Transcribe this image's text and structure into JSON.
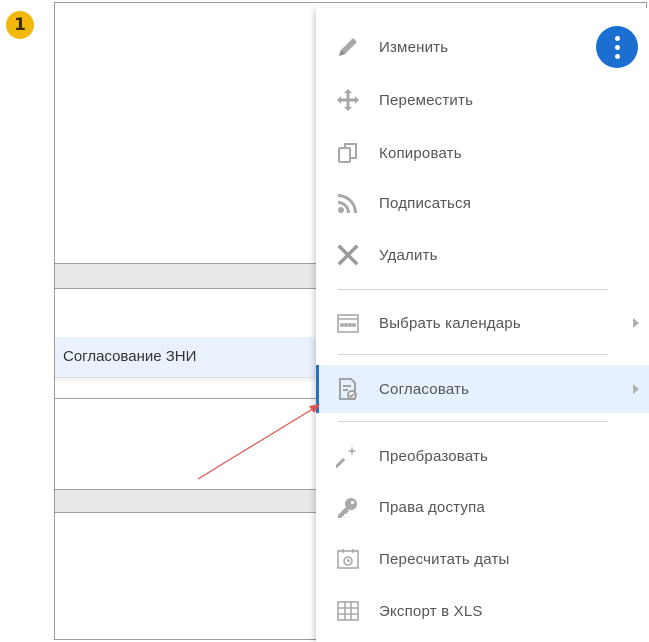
{
  "step_number": "1",
  "background": {
    "row_label": "Согласование ЗНИ"
  },
  "menu": {
    "items": [
      {
        "label": "Изменить",
        "icon": "pencil-icon"
      },
      {
        "label": "Переместить",
        "icon": "move-icon"
      },
      {
        "label": "Копировать",
        "icon": "copy-icon"
      },
      {
        "label": "Подписаться",
        "icon": "rss-icon"
      },
      {
        "label": "Удалить",
        "icon": "close-icon"
      },
      {
        "label": "Выбрать календарь",
        "icon": "calendar-icon",
        "has_submenu": true
      },
      {
        "label": "Согласовать",
        "icon": "approve-icon",
        "has_submenu": true,
        "active": true
      },
      {
        "label": "Преобразовать",
        "icon": "magic-wand-icon"
      },
      {
        "label": "Права доступа",
        "icon": "key-icon"
      },
      {
        "label": "Пересчитать даты",
        "icon": "recalc-dates-icon"
      },
      {
        "label": "Экспорт в XLS",
        "icon": "table-icon"
      }
    ],
    "more_button_icon": "more-vertical-icon"
  },
  "colors": {
    "accent": "#1a6fd0",
    "active_item_bg": "#e5f1fc",
    "badge": "#f2b80c",
    "annotation_arrow": "#d9534f"
  }
}
